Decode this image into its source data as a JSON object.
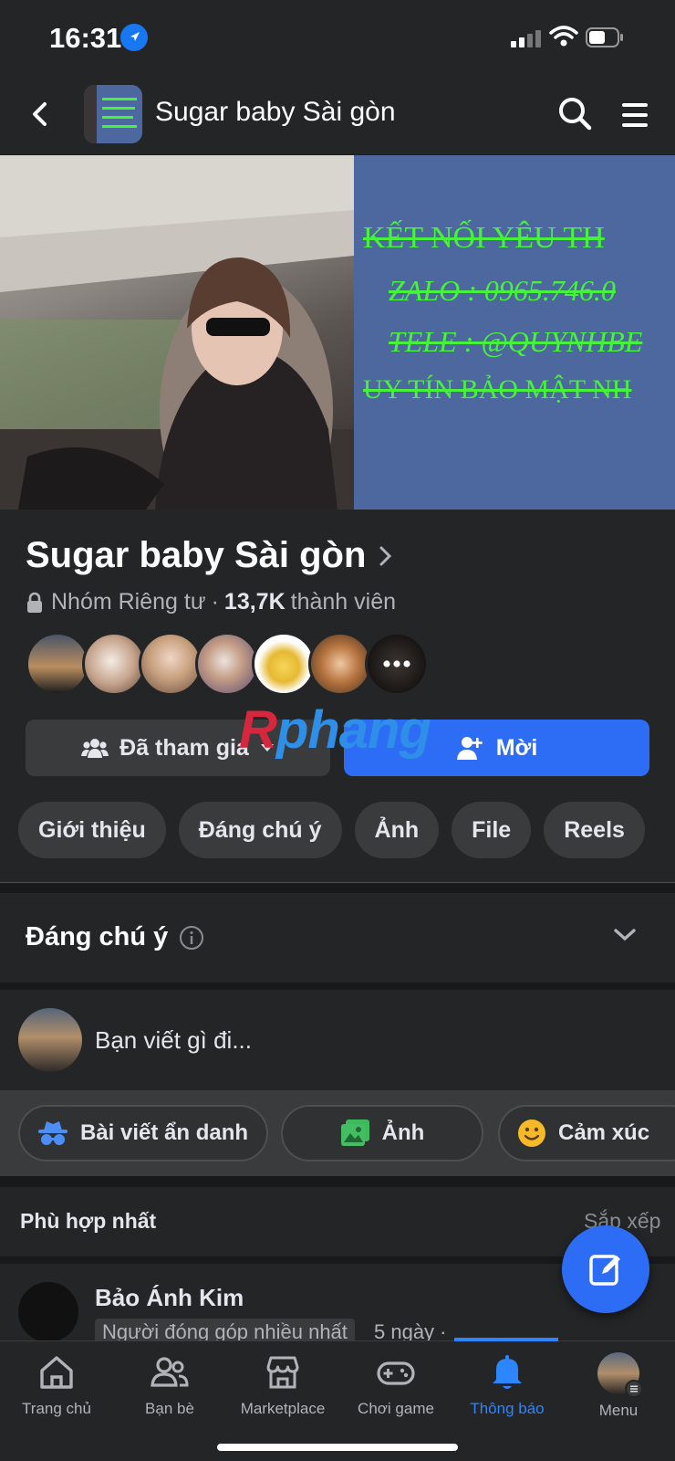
{
  "status_bar": {
    "time": "16:31"
  },
  "header": {
    "title": "Sugar baby Sài gòn"
  },
  "cover": {
    "banner_lines": [
      "KẾT NỐI YÊU TH",
      "ZALO : 0965.746.0",
      "TELE : @QUYNHBE",
      "UY TÍN BẢO MẬT NH"
    ]
  },
  "group": {
    "name": "Sugar baby Sài gòn",
    "privacy": "Nhóm Riêng tư",
    "separator": "·",
    "member_count": "13,7K",
    "member_label": "thành viên"
  },
  "actions": {
    "joined_label": "Đã tham gia",
    "invite_label": "Mời"
  },
  "watermark": {
    "a": "R",
    "b": "phang"
  },
  "tabs": [
    "Giới thiệu",
    "Đáng chú ý",
    "Ảnh",
    "File",
    "Reels"
  ],
  "featured": {
    "title": "Đáng chú ý"
  },
  "composer": {
    "placeholder": "Bạn viết gì đi..."
  },
  "post_actions": {
    "anonymous": "Bài viết ẩn danh",
    "photo": "Ảnh",
    "feeling": "Cảm xúc"
  },
  "feed": {
    "sort_title": "Phù hợp nhất",
    "sort_link": "Sắp xếp"
  },
  "post": {
    "author": "Bảo Ánh Kim",
    "badge": "Người đóng góp nhiều nhất",
    "time": "5 ngày ·"
  },
  "bottom_nav": [
    {
      "label": "Trang chủ",
      "icon": "home-icon"
    },
    {
      "label": "Bạn bè",
      "icon": "friends-icon"
    },
    {
      "label": "Marketplace",
      "icon": "marketplace-icon"
    },
    {
      "label": "Chơi game",
      "icon": "gaming-icon"
    },
    {
      "label": "Thông báo",
      "icon": "bell-icon"
    },
    {
      "label": "Menu",
      "icon": "profile-avatar"
    }
  ],
  "colors": {
    "accent": "#2d6df6",
    "background": "#242526",
    "surface": "#3a3b3c",
    "banner": "#4d679f",
    "banner_text": "#46f23a"
  }
}
